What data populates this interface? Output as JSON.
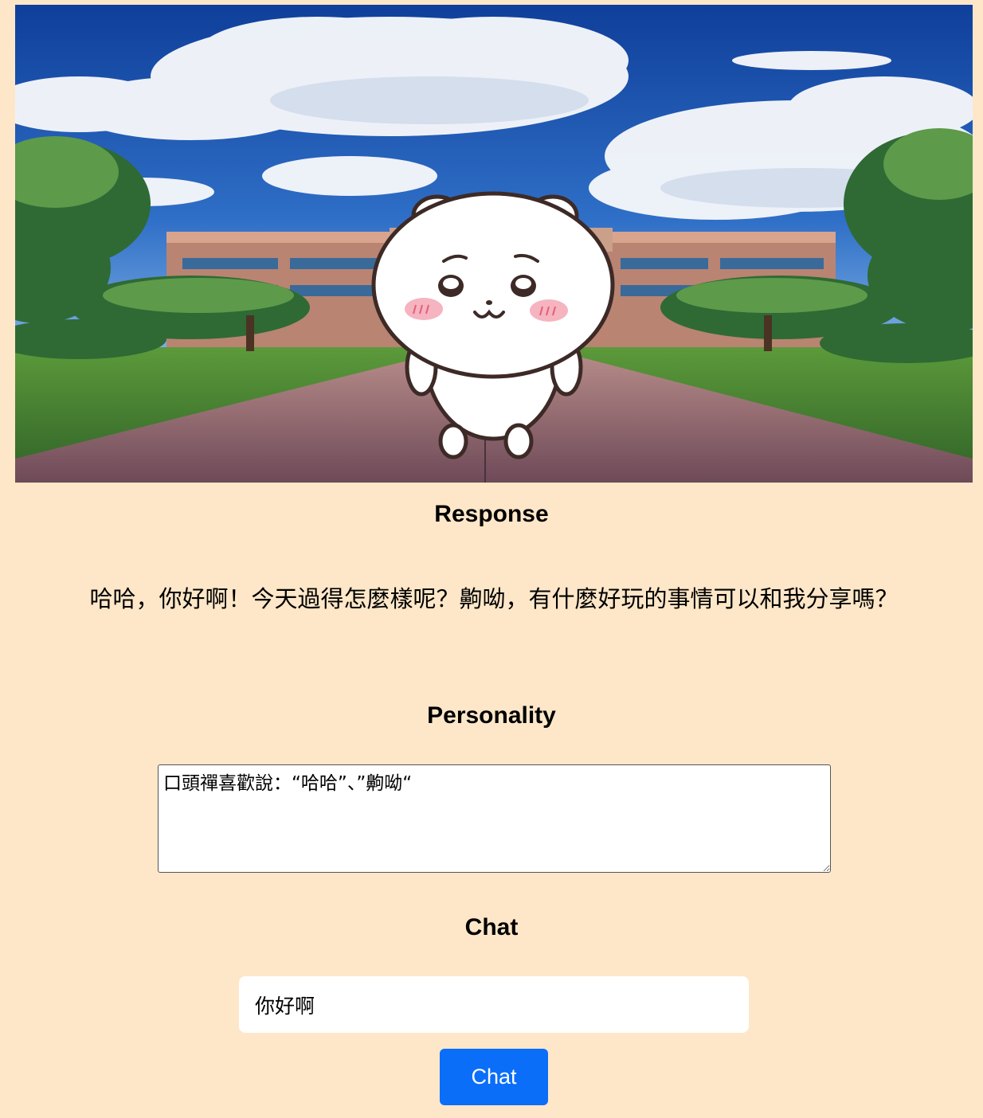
{
  "hero": {
    "description_icon": "character-scene"
  },
  "response": {
    "title": "Response",
    "text": "哈哈，你好啊！今天過得怎麼樣呢？齁呦，有什麼好玩的事情可以和我分享嗎？"
  },
  "personality": {
    "title": "Personality",
    "value": "口頭禪喜歡說：“哈哈”、”齁呦“"
  },
  "chat": {
    "title": "Chat",
    "input_value": "你好啊",
    "button_label": "Chat"
  },
  "colors": {
    "page_background": "#fee7c8",
    "button_blue": "#0b6ef9"
  }
}
